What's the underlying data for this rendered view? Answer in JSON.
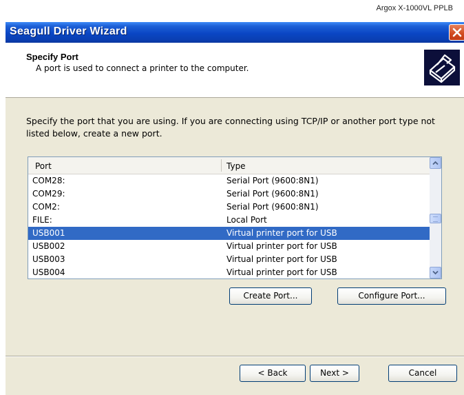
{
  "caption": "Argox X-1000VL PPLB",
  "window": {
    "title": "Seagull Driver Wizard"
  },
  "header": {
    "title": "Specify Port",
    "subtitle": "A port is used to connect a printer to the computer."
  },
  "instruction": "Specify the port that you are using.  If you are connecting using TCP/IP or another port type not listed below, create a new port.",
  "port_list": {
    "columns": [
      "Port",
      "Type"
    ],
    "rows": [
      {
        "port": "COM28:",
        "type": "Serial Port (9600:8N1)",
        "selected": false
      },
      {
        "port": "COM29:",
        "type": "Serial Port (9600:8N1)",
        "selected": false
      },
      {
        "port": "COM2:",
        "type": "Serial Port (9600:8N1)",
        "selected": false
      },
      {
        "port": "FILE:",
        "type": "Local Port",
        "selected": false
      },
      {
        "port": "USB001",
        "type": "Virtual printer port for USB",
        "selected": true
      },
      {
        "port": "USB002",
        "type": "Virtual printer port for USB",
        "selected": false
      },
      {
        "port": "USB003",
        "type": "Virtual printer port for USB",
        "selected": false
      },
      {
        "port": "USB004",
        "type": "Virtual printer port for USB",
        "selected": false
      }
    ]
  },
  "buttons": {
    "create_port": "Create Port...",
    "configure_port": "Configure Port...",
    "back": "< Back",
    "next": "Next >",
    "cancel": "Cancel"
  }
}
